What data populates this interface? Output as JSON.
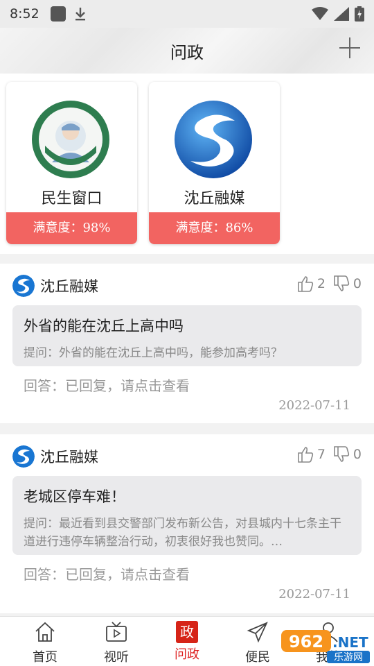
{
  "status": {
    "time": "8:52"
  },
  "header": {
    "title": "问政",
    "add_icon": "plus-icon"
  },
  "departments": [
    {
      "name": "民生窗口",
      "satisfaction": "满意度：98%",
      "accent": "#2e7d4f"
    },
    {
      "name": "沈丘融媒",
      "satisfaction": "满意度：86%",
      "accent": "#1565c0"
    }
  ],
  "posts": [
    {
      "author": "沈丘融媒",
      "likes": "2",
      "dislikes": "0",
      "title": "外省的能在沈丘上高中吗",
      "desc": "提问：外省的能在沈丘上高中吗，能参加高考吗？",
      "answer": "回答：已回复，请点击查看",
      "date": "2022-07-11"
    },
    {
      "author": "沈丘融媒",
      "likes": "7",
      "dislikes": "0",
      "title": "老城区停车难！",
      "desc": "提问：最近看到县交警部门发布新公告，对县城内十七条主干道进行违停车辆整治行动，初衷很好我也赞同。…",
      "answer": "回答：已回复，请点击查看",
      "date": "2022-07-11"
    }
  ],
  "tabs": [
    {
      "label": "首页",
      "icon": "home-icon"
    },
    {
      "label": "视听",
      "icon": "tv-icon"
    },
    {
      "label": "问政",
      "icon": "politics-icon",
      "glyph": "政"
    },
    {
      "label": "便民",
      "icon": "send-icon"
    },
    {
      "label": "我的",
      "icon": "user-icon"
    }
  ],
  "watermark": {
    "text1": "962",
    "text2": ".NET",
    "text3": "乐游网"
  },
  "colors": {
    "accent_red": "#f26461",
    "active_tab": "#d62418"
  }
}
